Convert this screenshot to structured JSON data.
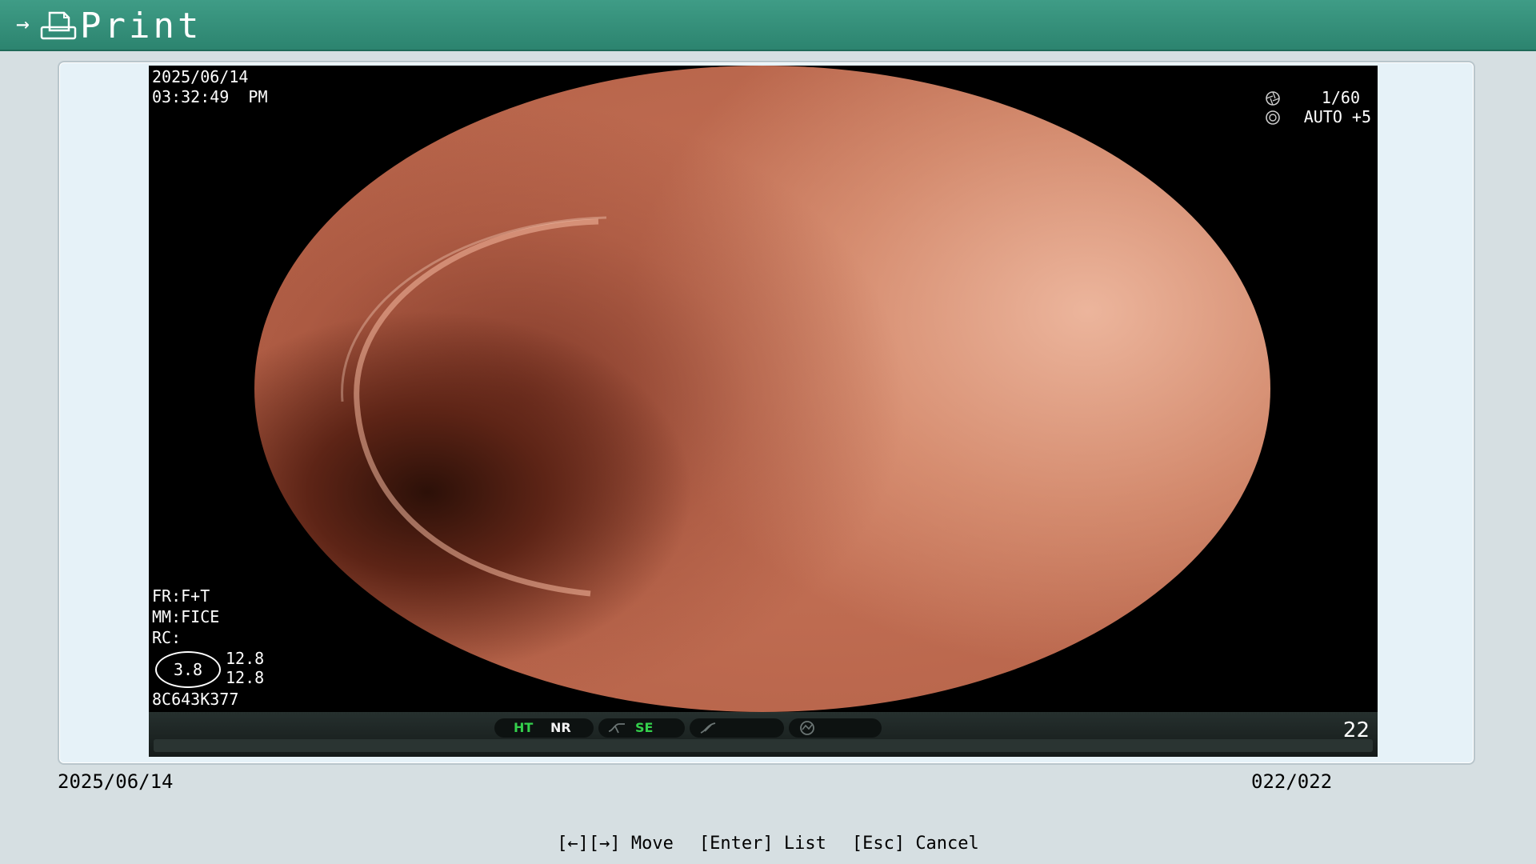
{
  "titlebar": {
    "title": "Print",
    "arrow": "→",
    "icon": "print-document-icon"
  },
  "image": {
    "date": "2025/06/14",
    "time": "03:32:49  PM",
    "shutter": "1/60",
    "iris": "AUTO +5",
    "fr": "FR:F+T",
    "mm": "MM:FICE",
    "rc": "RC:",
    "zoom": "3.8",
    "value_a": "12.8",
    "value_b": "12.8",
    "serial": "8C643K377",
    "status": {
      "ht": "HT",
      "nr": "NR",
      "se": "SE",
      "count": "22"
    }
  },
  "footer": {
    "date": "2025/06/14",
    "page": "022/022"
  },
  "help": {
    "move": "[←][→] Move",
    "list": "[Enter] List",
    "cancel": "[Esc] Cancel"
  }
}
